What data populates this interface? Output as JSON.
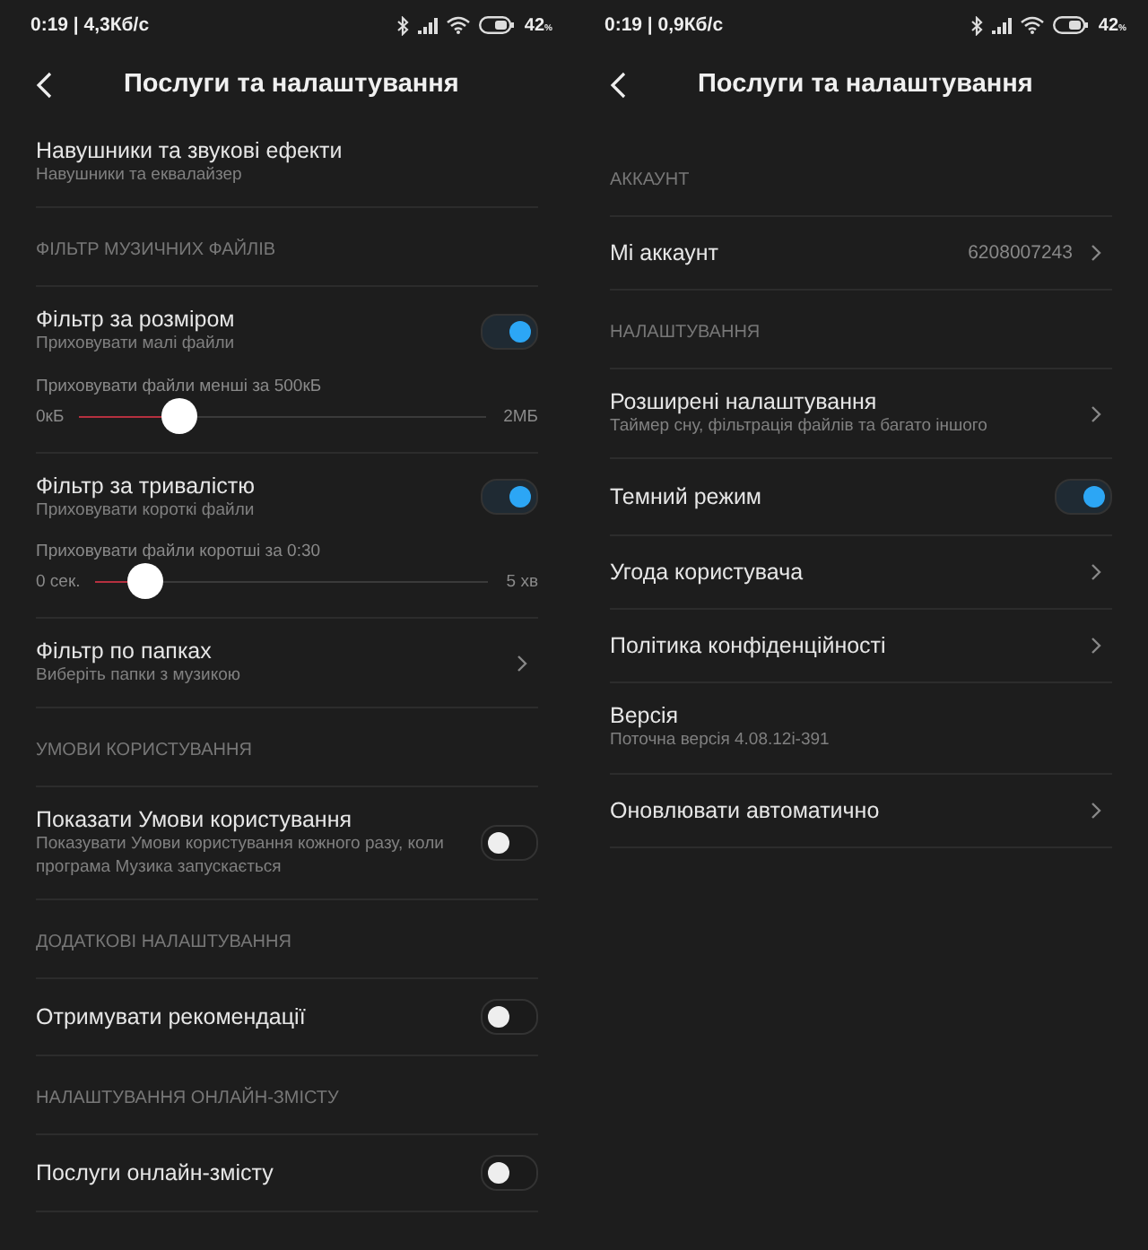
{
  "screens": [
    {
      "status_bar": {
        "time": "0:19 | 4,3Кб/с",
        "battery": "42$_{%}$"
      },
      "title": "Послуги та налаштування",
      "items": [
        {
          "kind": "item",
          "title": "Навушники та звукові ефекти",
          "subtitle": "Навушники та еквалайзер"
        },
        {
          "kind": "header",
          "title": "ФІЛЬТР МУЗИЧНИХ ФАЙЛІВ"
        },
        {
          "kind": "slider_item",
          "title": "Фільтр за розміром",
          "subtitle": "Приховувати малі файли",
          "trailing": {
            "kind": "toggle",
            "on": true
          },
          "slider": {
            "label": "Приховувати файли менші за 500кБ",
            "min": "0кБ",
            "max": "2МБ",
            "level": 0.25
          }
        },
        {
          "kind": "slider_item",
          "title": "Фільтр за тривалістю",
          "subtitle": "Приховувати короткі файли",
          "trailing": {
            "kind": "toggle",
            "on": true
          },
          "slider": {
            "label": "Приховувати файли коротші за 0:30",
            "min": "0 сек.",
            "max": "5 хв",
            "level": 0.13
          }
        },
        {
          "kind": "item",
          "title": "Фільтр по папках",
          "subtitle": "Виберіть папки з музикою",
          "trailing": {
            "kind": "chevron"
          }
        },
        {
          "kind": "header",
          "title": "УМОВИ КОРИСТУВАННЯ"
        },
        {
          "kind": "item",
          "title": "Показати Умови користування",
          "subtitle": "Показувати Умови користування кожного разу, коли програма Музика запускається",
          "trailing": {
            "kind": "toggle",
            "on": false
          }
        },
        {
          "kind": "header",
          "title": "ДОДАТКОВІ НАЛАШТУВАННЯ"
        },
        {
          "kind": "item",
          "title": "Отримувати рекомендації",
          "trailing": {
            "kind": "toggle",
            "on": false
          }
        },
        {
          "kind": "header",
          "title": "НАЛАШТУВАННЯ ОНЛАЙН-ЗМІСТУ"
        },
        {
          "kind": "item",
          "title": "Послуги онлайн-змісту",
          "trailing": {
            "kind": "toggle",
            "on": false
          }
        }
      ]
    },
    {
      "status_bar": {
        "time": "0:19 | 0,9Кб/с",
        "battery": "42$_{%}$"
      },
      "title": "Послуги та налаштування",
      "items": [
        {
          "kind": "header",
          "title": "АККАУНТ"
        },
        {
          "kind": "item",
          "title": "Мі аккаунт",
          "value": "6208007243",
          "trailing": {
            "kind": "chevron"
          }
        },
        {
          "kind": "header",
          "title": "НАЛАШТУВАННЯ"
        },
        {
          "kind": "item",
          "title": "Розширені налаштування",
          "subtitle": "Таймер сну, фільтрація файлів та багато іншого",
          "trailing": {
            "kind": "chevron"
          }
        },
        {
          "kind": "item",
          "title": "Темний режим",
          "trailing": {
            "kind": "toggle",
            "on": true
          }
        },
        {
          "kind": "item",
          "title": "Угода користувача",
          "trailing": {
            "kind": "chevron"
          }
        },
        {
          "kind": "item",
          "title": "Політика конфіденційності",
          "trailing": {
            "kind": "chevron"
          }
        },
        {
          "kind": "item",
          "title": "Версія",
          "subtitle": "Поточна версія 4.08.12i-391"
        },
        {
          "kind": "item",
          "title": "Оновлювати автоматично",
          "trailing": {
            "kind": "chevron"
          }
        }
      ]
    }
  ]
}
